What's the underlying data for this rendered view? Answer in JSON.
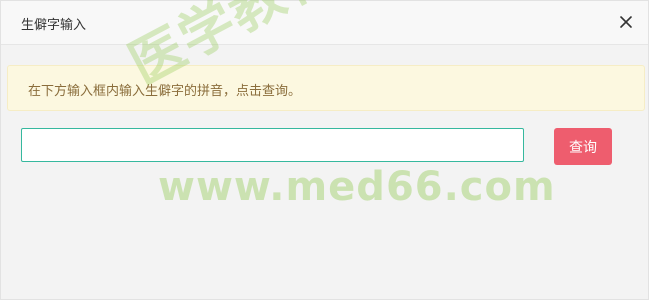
{
  "dialog": {
    "title": "生僻字输入",
    "close_icon": "close-icon"
  },
  "alert": {
    "text": "在下方输入框内输入生僻字的拼音，点击查询。"
  },
  "search": {
    "value": "",
    "placeholder": ""
  },
  "query_button": {
    "label": "查询"
  },
  "watermark": {
    "cn_text": "医学教育网",
    "url_text": "www.med66.com"
  },
  "colors": {
    "header_bg": "#f8f8f8",
    "alert_bg": "#fcf8e0",
    "alert_text": "#8a6d3b",
    "input_border": "#36b89e",
    "button_bg": "#ee5d6e",
    "watermark": "#8cc846"
  }
}
